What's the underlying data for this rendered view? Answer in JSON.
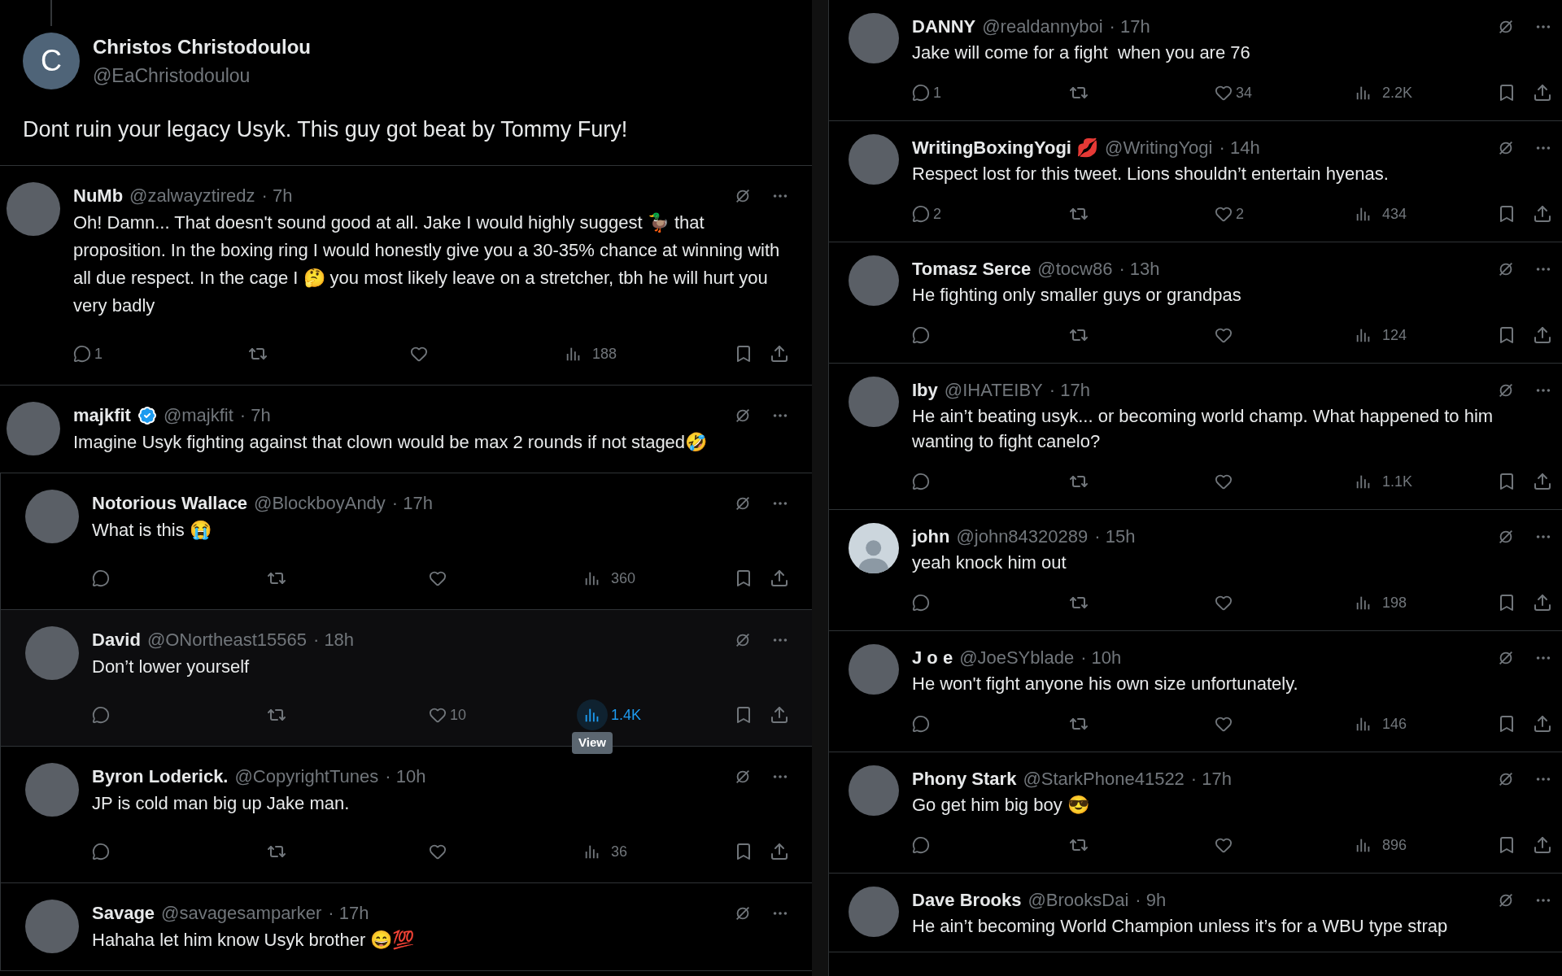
{
  "original_post": {
    "name": "Christos Christodoulou",
    "handle": "@EaChristodoulou",
    "avatar": {
      "kind": "letter",
      "letter": "C"
    },
    "text": "Dont ruin your legacy Usyk. This guy got beat by Tommy Fury!"
  },
  "left_replies": [
    {
      "nested": false,
      "highlighted": false,
      "avatar": {
        "kind": "photo"
      },
      "name": "NuMb",
      "verified": false,
      "handle": "@zalwayztiredz",
      "time": "· 7h",
      "text": "Oh! Damn... That doesn't sound good at all. Jake I would highly suggest 🦆 that proposition. In the boxing ring I would honestly give you a 30-35% chance at winning with all due respect. In the cage I 🤔 you most likely leave on a stretcher, tbh he will hurt you very badly",
      "actions": {
        "replies": "1",
        "views": "188",
        "views_hovered": false
      }
    },
    {
      "nested": false,
      "highlighted": false,
      "avatar": {
        "kind": "photo"
      },
      "name": "majkfit",
      "verified": true,
      "handle": "@majkfit",
      "time": "· 7h",
      "text": "Imagine Usyk fighting against that clown would be max 2 rounds if not staged🤣"
    },
    {
      "nested": true,
      "highlighted": false,
      "avatar": {
        "kind": "photo"
      },
      "name": "Notorious Wallace",
      "verified": false,
      "handle": "@BlockboyAndy",
      "time": "· 17h",
      "text": "What is this 😭",
      "actions": {
        "views": "360",
        "views_hovered": false
      }
    },
    {
      "nested": true,
      "highlighted": true,
      "avatar": {
        "kind": "photo"
      },
      "name": "David",
      "verified": false,
      "handle": "@ONortheast15565",
      "time": "· 18h",
      "text": "Don’t lower yourself",
      "actions": {
        "likes": "10",
        "views": "1.4K",
        "views_hovered": true,
        "tooltip": "View"
      }
    },
    {
      "nested": true,
      "highlighted": false,
      "avatar": {
        "kind": "photo"
      },
      "name": "Byron Loderick.",
      "verified": false,
      "handle": "@CopyrightTunes",
      "time": "· 10h",
      "text": "JP is cold man big up Jake man.",
      "actions": {
        "views": "36",
        "views_hovered": false
      }
    },
    {
      "nested": true,
      "highlighted": false,
      "avatar": {
        "kind": "photo"
      },
      "name": "Savage",
      "verified": false,
      "handle": "@savagesamparker",
      "time": "· 17h",
      "text": "Hahaha let him know Usyk brother 😄💯"
    }
  ],
  "right_replies": [
    {
      "nested": false,
      "highlighted": false,
      "avatar": {
        "kind": "photo"
      },
      "name": "DANNY",
      "verified": false,
      "handle": "@realdannyboi",
      "time": "· 17h",
      "text": "Jake will come for a fight  when you are 76",
      "actions": {
        "replies": "1",
        "likes": "34",
        "views": "2.2K",
        "views_hovered": false
      }
    },
    {
      "nested": false,
      "highlighted": false,
      "avatar": {
        "kind": "photo"
      },
      "name": "WritingBoxingYogi 💋",
      "verified": false,
      "handle": "@WritingYogi",
      "time": "· 14h",
      "text": "Respect lost for this tweet. Lions shouldn’t entertain hyenas.",
      "actions": {
        "replies": "2",
        "likes": "2",
        "views": "434",
        "views_hovered": false
      }
    },
    {
      "nested": false,
      "highlighted": false,
      "avatar": {
        "kind": "photo"
      },
      "name": "Tomasz Serce",
      "verified": false,
      "handle": "@tocw86",
      "time": "· 13h",
      "text": "He fighting only smaller guys or grandpas",
      "actions": {
        "views": "124",
        "views_hovered": false
      }
    },
    {
      "nested": false,
      "highlighted": false,
      "avatar": {
        "kind": "photo"
      },
      "name": "Iby",
      "verified": false,
      "handle": "@IHATEIBY",
      "time": "· 17h",
      "text": "He ain’t beating usyk... or becoming world champ. What happened to him wanting to fight canelo?",
      "actions": {
        "views": "1.1K",
        "views_hovered": false
      }
    },
    {
      "nested": false,
      "highlighted": false,
      "avatar": {
        "kind": "default"
      },
      "name": "john",
      "verified": false,
      "handle": "@john84320289",
      "time": "· 15h",
      "text": "yeah knock him out",
      "actions": {
        "views": "198",
        "views_hovered": false
      }
    },
    {
      "nested": false,
      "highlighted": false,
      "avatar": {
        "kind": "photo"
      },
      "name": "J o e",
      "verified": false,
      "handle": "@JoeSYblade",
      "time": "· 10h",
      "text": "He won't fight anyone his own size unfortunately.",
      "actions": {
        "views": "146",
        "views_hovered": false
      }
    },
    {
      "nested": false,
      "highlighted": false,
      "avatar": {
        "kind": "photo"
      },
      "name": "Phony Stark",
      "verified": false,
      "handle": "@StarkPhone41522",
      "time": "· 17h",
      "text": "Go get him big boy 😎",
      "actions": {
        "views": "896",
        "views_hovered": false
      }
    },
    {
      "nested": false,
      "highlighted": false,
      "avatar": {
        "kind": "photo"
      },
      "name": "Dave Brooks",
      "verified": false,
      "handle": "@BrooksDai",
      "time": "· 9h",
      "text": "He ain’t becoming World Champion unless it’s for a WBU type strap"
    }
  ]
}
